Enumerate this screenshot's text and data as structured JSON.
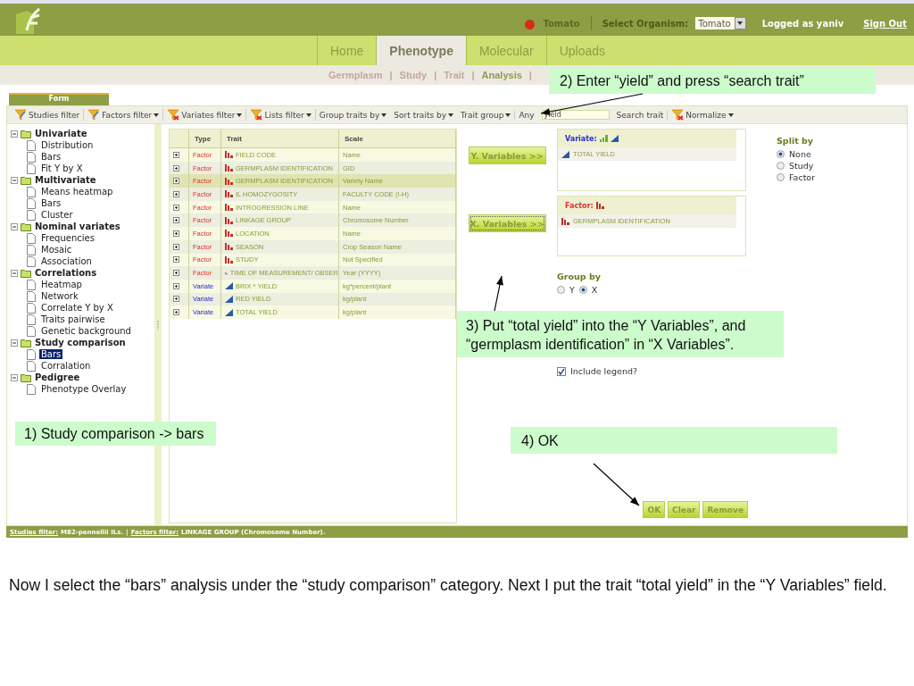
{
  "header": {
    "organism": "Tomato",
    "select_label": "Select Organism:",
    "select_value": "Tomato",
    "user": "Logged as yaniv",
    "sign_out": "Sign Out"
  },
  "nav_tabs": [
    {
      "label": "Home",
      "selected": false
    },
    {
      "label": "Phenotype",
      "selected": true
    },
    {
      "label": "Molecular",
      "selected": false
    },
    {
      "label": "Uploads",
      "selected": false
    }
  ],
  "subnav": [
    {
      "label": "Germplasm",
      "selected": false
    },
    {
      "label": "Study",
      "selected": false
    },
    {
      "label": "Trait",
      "selected": false
    },
    {
      "label": "Analysis",
      "selected": true
    }
  ],
  "subnav_separator": "|",
  "form_tab": "Form",
  "toolbar": [
    {
      "kind": "filter",
      "label": "Studies filter",
      "dropdown": false,
      "cleared": false
    },
    {
      "kind": "filter",
      "label": "Factors filter",
      "dropdown": true,
      "cleared": false
    },
    {
      "kind": "filter",
      "label": "Variates filter",
      "dropdown": true,
      "cleared": true
    },
    {
      "kind": "filter",
      "label": "Lists filter",
      "dropdown": true,
      "cleared": true
    },
    {
      "kind": "menu",
      "label": "Group traits by"
    },
    {
      "kind": "menu",
      "label": "Sort traits by"
    },
    {
      "kind": "menu",
      "label": "Trait group"
    },
    {
      "kind": "text",
      "label": "Any"
    },
    {
      "kind": "input",
      "value": "yield"
    },
    {
      "kind": "text",
      "label": "Search trait"
    },
    {
      "kind": "filter",
      "label": "Normalize",
      "dropdown": true,
      "cleared": true
    }
  ],
  "tree": [
    {
      "label": "Univariate",
      "expanded": true,
      "children": [
        {
          "label": "Distribution",
          "selected": false
        },
        {
          "label": "Bars",
          "selected": false
        },
        {
          "label": "Fit Y by X",
          "selected": false
        }
      ]
    },
    {
      "label": "Multivariate",
      "expanded": true,
      "children": [
        {
          "label": "Means heatmap",
          "selected": false
        },
        {
          "label": "Bars",
          "selected": false
        },
        {
          "label": "Cluster",
          "selected": false
        }
      ]
    },
    {
      "label": "Nominal variates",
      "expanded": true,
      "children": [
        {
          "label": "Frequencies",
          "selected": false
        },
        {
          "label": "Mosaic",
          "selected": false
        },
        {
          "label": "Association",
          "selected": false
        }
      ]
    },
    {
      "label": "Correlations",
      "expanded": true,
      "children": [
        {
          "label": "Heatmap",
          "selected": false
        },
        {
          "label": "Network",
          "selected": false
        },
        {
          "label": "Correlate Y by X",
          "selected": false
        },
        {
          "label": "Traits pairwise",
          "selected": false
        },
        {
          "label": "Genetic background",
          "selected": false
        }
      ]
    },
    {
      "label": "Study comparison",
      "expanded": true,
      "children": [
        {
          "label": "Bars",
          "selected": true
        },
        {
          "label": "Corralation",
          "selected": false
        }
      ]
    },
    {
      "label": "Pedigree",
      "expanded": true,
      "children": [
        {
          "label": "Phenotype Overlay",
          "selected": false
        }
      ]
    }
  ],
  "table": {
    "columns": [
      "Type",
      "Trait",
      "Scale"
    ],
    "rows": [
      {
        "kind": "factor",
        "type": "Factor",
        "trait": "FIELD CODE",
        "scale": "Name",
        "selected": false
      },
      {
        "kind": "factor",
        "type": "Factor",
        "trait": "GERMPLASM IDENTIFICATION",
        "scale": "GID",
        "selected": false
      },
      {
        "kind": "factor",
        "type": "Factor",
        "trait": "GERMPLASM IDENTIFICATION",
        "scale": "Variety Name",
        "selected": true
      },
      {
        "kind": "factor",
        "type": "Factor",
        "trait": "IL HOMOZYGOSITY",
        "scale": "FACULTY CODE (I-H)",
        "selected": false
      },
      {
        "kind": "factor",
        "type": "Factor",
        "trait": "INTROGRESSION LINE",
        "scale": "Name",
        "selected": false
      },
      {
        "kind": "factor",
        "type": "Factor",
        "trait": "LINKAGE GROUP",
        "scale": "Chromosome Number",
        "selected": false
      },
      {
        "kind": "factor",
        "type": "Factor",
        "trait": "LOCATION",
        "scale": "Name",
        "selected": false
      },
      {
        "kind": "factor",
        "type": "Factor",
        "trait": "SEASON",
        "scale": "Crop Season Name",
        "selected": false
      },
      {
        "kind": "factor",
        "type": "Factor",
        "trait": "STUDY",
        "scale": "Not Specified",
        "selected": false
      },
      {
        "kind": "factor",
        "type": "Factor",
        "trait": "TIME OF MEASUREMENT/ OBSER",
        "scale": "Year (YYYY)",
        "selected": false
      },
      {
        "kind": "variate",
        "type": "Variate",
        "trait": "BRIX * YIELD",
        "scale": "kg*percent/plant",
        "selected": false
      },
      {
        "kind": "variate",
        "type": "Variate",
        "trait": "RED YIELD",
        "scale": "kg/plant",
        "selected": false
      },
      {
        "kind": "variate",
        "type": "Variate",
        "trait": "TOTAL YIELD",
        "scale": "kg/plant",
        "selected": false
      }
    ]
  },
  "move_buttons": [
    "Y. Variables >>",
    "X. Variables >>"
  ],
  "boxes": [
    {
      "kind": "variate",
      "title": "Variate:",
      "items": [
        {
          "kind": "variate",
          "trait": "TOTAL YIELD"
        }
      ]
    },
    {
      "kind": "factor",
      "title": "Factor:",
      "items": [
        {
          "kind": "factor",
          "trait": "GERMPLASM IDENTIFICATION"
        }
      ]
    }
  ],
  "split_by": {
    "title": "Split by",
    "options": [
      {
        "label": "None",
        "selected": true
      },
      {
        "label": "Study",
        "selected": false
      },
      {
        "label": "Factor",
        "selected": false
      }
    ]
  },
  "group_by": {
    "title": "Group by",
    "options": [
      {
        "label": "Y",
        "selected": false
      },
      {
        "label": "X",
        "selected": true
      }
    ]
  },
  "include_legend": {
    "label": "Include legend?",
    "checked": true
  },
  "action_buttons": [
    "OK",
    "Clear",
    "Remove"
  ],
  "status_bar": {
    "items": [
      {
        "label": "Studies filter:",
        "value": "M82-pennellii ILs."
      },
      {
        "label": "Factors filter:",
        "value": "LINKAGE GROUP (Chromosome Number)."
      }
    ],
    "separator": "|"
  },
  "callouts": [
    {
      "text": "2) Enter “yield” and press “search trait”"
    },
    {
      "text": "3) Put “total yield” into the “Y Variables”, and “germplasm identification” in “X Variables”."
    },
    {
      "text": "1) Study comparison -> bars"
    },
    {
      "text": "4) OK"
    }
  ],
  "caption": "Now I select the “bars” analysis under the “study comparison” category. Next I put the trait “total yield” in the “Y Variables” field."
}
